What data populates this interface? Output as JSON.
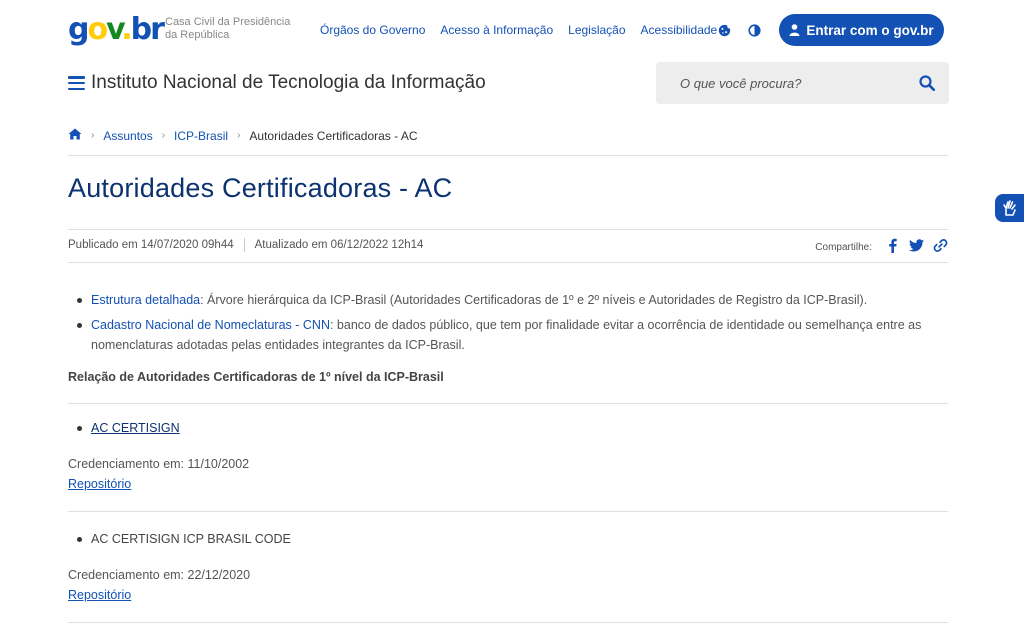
{
  "top": {
    "logo": {
      "g": "g",
      "o": "o",
      "v": "v",
      "dot": ".",
      "br": "br"
    },
    "org_name": "Casa Civil da Presidência da República",
    "nav": [
      "Órgãos do Governo",
      "Acesso à Informação",
      "Legislação",
      "Acessibilidade"
    ],
    "login_label": "Entrar com o gov.br"
  },
  "header": {
    "site_title": "Instituto Nacional de Tecnologia da Informação",
    "search_placeholder": "O que você procura?"
  },
  "breadcrumb": {
    "items": [
      "Assuntos",
      "ICP-Brasil"
    ],
    "current": "Autoridades Certificadoras - AC"
  },
  "page": {
    "title": "Autoridades Certificadoras - AC",
    "published": "Publicado em 14/07/2020 09h44",
    "updated": "Atualizado em 06/12/2022 12h14",
    "share_label": "Compartilhe:"
  },
  "bullets": [
    {
      "link": "Estrutura detalhada",
      "text": ": Árvore hierárquica da ICP-Brasil (Autoridades Certificadoras de 1º e 2º níveis e Autoridades de Registro da ICP-Brasil)."
    },
    {
      "link": "Cadastro Nacional de Nomeclaturas - CNN",
      "text": ": banco de dados público, que tem por finalidade evitar a ocorrência de identidade ou semelhança entre as nomenclaturas adotadas pelas entidades integrantes da ICP-Brasil."
    }
  ],
  "section_title": "Relação de Autoridades Certificadoras de 1º nível da ICP-Brasil",
  "entries": [
    {
      "name": "AC CERTISIGN",
      "credenciamento": "Credenciamento em: 11/10/2002",
      "repo": "Repositório"
    },
    {
      "name": "AC CERTISIGN ICP BRASIL CODE",
      "credenciamento": "Credenciamento em: 22/12/2020",
      "repo": "Repositório"
    }
  ],
  "colors": {
    "primary": "#1351b4",
    "title": "#0c326f",
    "search_bg": "#ededed"
  },
  "icons": [
    "cookie-icon",
    "contrast-icon",
    "user-icon",
    "menu-icon",
    "search-icon",
    "home-icon",
    "facebook-icon",
    "twitter-icon",
    "link-icon",
    "hand-talk-icon"
  ]
}
